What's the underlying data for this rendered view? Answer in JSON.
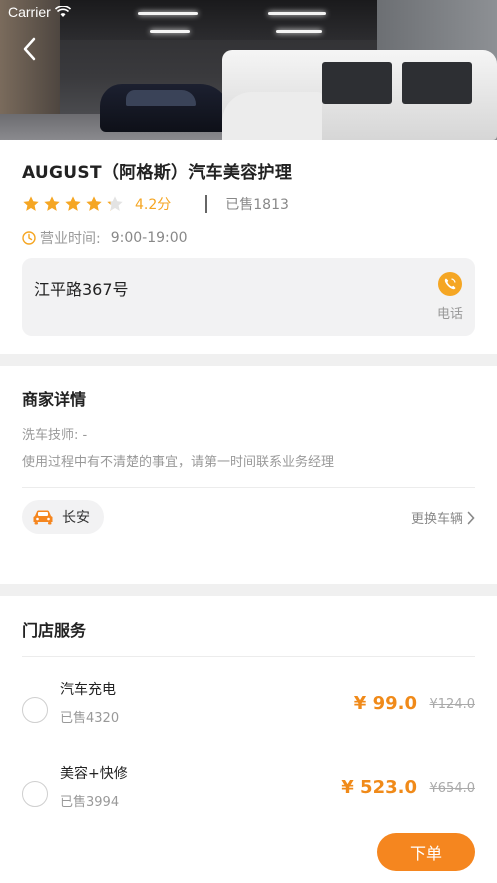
{
  "status_bar": {
    "carrier": "Carrier"
  },
  "shop": {
    "title": "AUGUST（阿格斯）汽车美容护理",
    "rating": 4.2,
    "rating_text": "4.2分",
    "sold_text": "已售1813",
    "hours_label": "营业时间:",
    "hours_value": "9:00-19:00",
    "address": "江平路367号",
    "phone_label": "电话"
  },
  "details": {
    "title": "商家详情",
    "technician": "洗车技师: -",
    "note": "使用过程中有不清楚的事宜，请第一时间联系业务经理",
    "car_name": "长安",
    "swap_label": "更换车辆"
  },
  "services": {
    "title": "门店服务",
    "items": [
      {
        "name": "汽车充电",
        "sold": "已售4320",
        "price": "¥ 99.0",
        "original": "¥124.0"
      },
      {
        "name": "美容+快修",
        "sold": "已售3994",
        "price": "¥ 523.0",
        "original": "¥654.0"
      }
    ]
  },
  "order_button": "下单",
  "colors": {
    "accent": "#f5861f",
    "star": "#f5a623",
    "price": "#f08a19"
  },
  "icons": [
    "back-arrow-icon",
    "star-icon",
    "clock-icon",
    "phone-icon",
    "car-icon",
    "chevron-right-icon"
  ]
}
